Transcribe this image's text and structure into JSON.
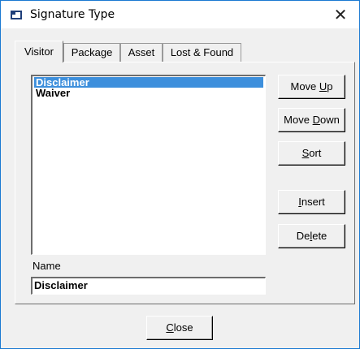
{
  "window": {
    "title": "Signature Type",
    "close_glyph": "✕"
  },
  "tabs": [
    {
      "label": "Visitor",
      "active": true
    },
    {
      "label": "Package",
      "active": false
    },
    {
      "label": "Asset",
      "active": false
    },
    {
      "label": "Lost & Found",
      "active": false
    }
  ],
  "list": {
    "items": [
      {
        "label": "Disclaimer",
        "selected": true
      },
      {
        "label": "Waiver",
        "selected": false
      }
    ],
    "selection_color": "#3d8fdc"
  },
  "name": {
    "label": "Name",
    "value": "Disclaimer"
  },
  "buttons": {
    "move_up": {
      "pre": "Move ",
      "key": "U",
      "post": "p"
    },
    "move_down": {
      "pre": "Move ",
      "key": "D",
      "post": "own"
    },
    "sort": {
      "pre": "",
      "key": "S",
      "post": "ort"
    },
    "insert": {
      "pre": "",
      "key": "I",
      "post": "nsert"
    },
    "delete": {
      "pre": "De",
      "key": "l",
      "post": "ete"
    },
    "close": {
      "pre": "",
      "key": "C",
      "post": "lose"
    }
  }
}
